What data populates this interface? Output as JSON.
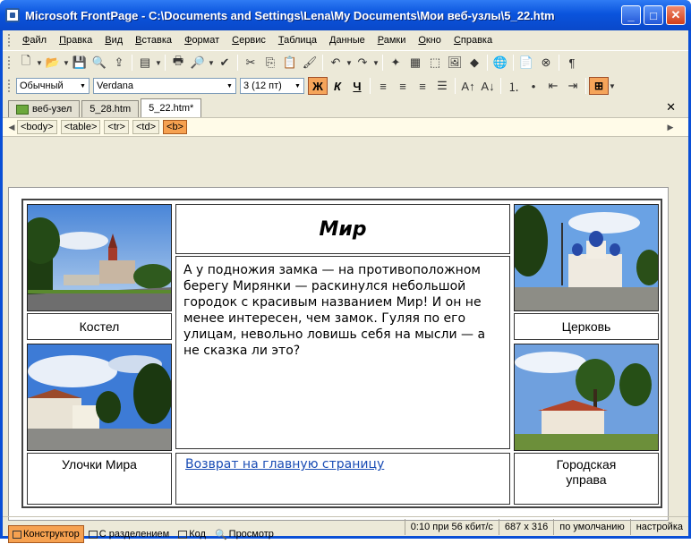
{
  "window": {
    "title": "Microsoft FrontPage - C:\\Documents and Settings\\Lena\\My Documents\\Мои веб-узлы\\5_22.htm"
  },
  "menu": [
    "Файл",
    "Правка",
    "Вид",
    "Вставка",
    "Формат",
    "Сервис",
    "Таблица",
    "Данные",
    "Рамки",
    "Окно",
    "Справка"
  ],
  "format": {
    "style": "Обычный",
    "font": "Verdana",
    "size": "3  (12 пт)",
    "bold": "Ж",
    "italic": "К",
    "underline": "Ч"
  },
  "tabs": [
    {
      "label": "веб-узел"
    },
    {
      "label": "5_28.htm"
    },
    {
      "label": "5_22.htm*"
    }
  ],
  "tags": [
    "<body>",
    "<table>",
    "<tr>",
    "<td>",
    "<b>"
  ],
  "page": {
    "title": "Мир",
    "text": "А у подножия замка — на противоположном берегу Мирянки — раскинулся небольшой городок с красивым названием Мир! И он не менее интересен, чем замок. Гуляя по его улицам, невольно ловишь себя на мысли — а не сказка ли это?",
    "link": "Возврат на главную страницу",
    "captions": {
      "top_left": "Костел",
      "top_right": "Церковь",
      "bottom_left": "Улочки Мира",
      "bottom_right": "Городская управа"
    }
  },
  "views": [
    "Конструктор",
    "С разделением",
    "Код",
    "Просмотр"
  ],
  "status": [
    "0:10 при 56 кбит/с",
    "687 x 316",
    "по умолчанию",
    "настройка"
  ]
}
